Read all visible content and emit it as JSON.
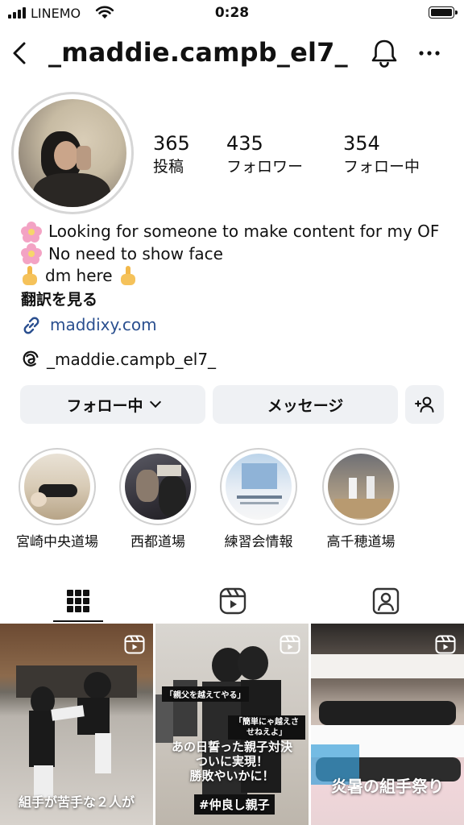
{
  "status_bar": {
    "carrier": "LINEMO",
    "time": "0:28"
  },
  "header": {
    "username": "_maddie.campb_el7_"
  },
  "stats": [
    {
      "value": "365",
      "label": "投稿"
    },
    {
      "value": "435",
      "label": "フォロワー"
    },
    {
      "value": "354",
      "label": "フォロー中"
    }
  ],
  "bio": {
    "line1": "Looking for someone to make content for my OF",
    "line2": "No need to show face",
    "line3": "dm here",
    "translate": "翻訳を見る",
    "link": "maddixy.com"
  },
  "threads": {
    "handle": "_maddie.campb_el7_"
  },
  "buttons": {
    "following": "フォロー中",
    "message": "メッセージ"
  },
  "highlights": [
    {
      "label": "宮崎中央道場"
    },
    {
      "label": "西都道場"
    },
    {
      "label": "練習会情報"
    },
    {
      "label": "高千穂道場"
    }
  ],
  "grid": [
    {
      "caption": "組手が苦手な２人が"
    },
    {
      "caption_top1": "「親父を越えてやる」",
      "caption_top2": "「簡単にゃ越えさせねえよ」",
      "caption_main": "あの日誓った親子対決\nついに実現！\n勝敗やいかに！",
      "caption_tag": "#仲良し親子"
    },
    {
      "caption": "炎暑の組手祭り"
    }
  ],
  "colors": {
    "link": "#2a4f8f",
    "button_bg": "#eff1f4",
    "pink_flower": "#f3a3c4"
  }
}
